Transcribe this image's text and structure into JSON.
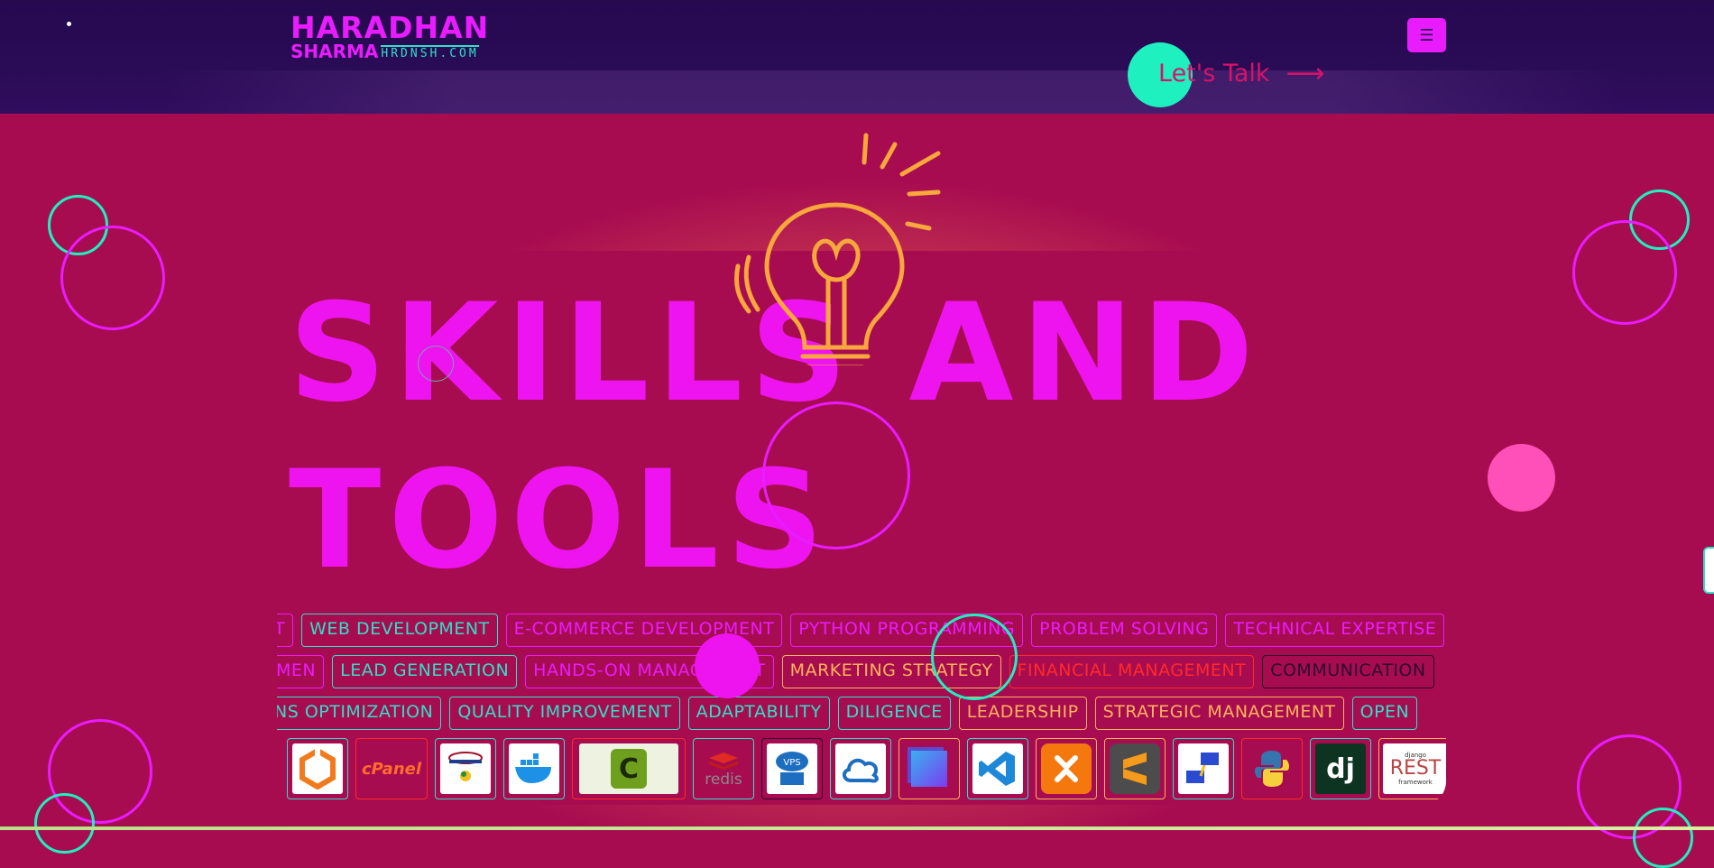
{
  "header": {
    "logo_line1": "HARADHAN",
    "logo_line2": "SHARMA",
    "logo_domain": "HRDNSH.COM",
    "menu_icon": "hamburger-icon",
    "cta_label": "Let's Talk",
    "cta_icon": "arrow-right-icon"
  },
  "hero": {
    "title_line1": "SKILLS AND",
    "title_line2": "TOOLS",
    "decoration_icon": "lightbulb-icon"
  },
  "skills": {
    "row1": [
      {
        "label": "WEB DEVELOPMENT",
        "color": "teal"
      },
      {
        "label": "E-COMMERCE DEVELOPMENT",
        "color": "pink"
      },
      {
        "label": "PYTHON PROGRAMMING",
        "color": "pink"
      },
      {
        "label": "PROBLEM SOLVING",
        "color": "pink"
      },
      {
        "label": "TECHNICAL EXPERTISE",
        "color": "pink"
      }
    ],
    "row1_lead": "T",
    "row2": [
      {
        "label": "LEAD GENERATION",
        "color": "teal"
      },
      {
        "label": "HANDS-ON MANAGEMENT",
        "color": "pink"
      },
      {
        "label": "MARKETING STRATEGY",
        "color": "orange"
      },
      {
        "label": "FINANCIAL MANAGEMENT",
        "color": "red"
      },
      {
        "label": "COMMUNICATION",
        "color": "dark"
      }
    ],
    "row2_lead": "MEN",
    "row3": [
      {
        "label": "QUALITY IMPROVEMENT",
        "color": "teal"
      },
      {
        "label": "ADAPTABILITY",
        "color": "teal"
      },
      {
        "label": "DILIGENCE",
        "color": "teal"
      },
      {
        "label": "LEADERSHIP",
        "color": "orange"
      },
      {
        "label": "STRATEGIC MANAGEMENT",
        "color": "orange"
      },
      {
        "label": "OPEN",
        "color": "teal"
      }
    ],
    "row3_lead": "NS OPTIMIZATION"
  },
  "tools": [
    {
      "icon": "ubuntu-icon",
      "label": ""
    },
    {
      "icon": "cpanel-icon",
      "label": "cPanel"
    },
    {
      "icon": "control-panel-icon",
      "label": ""
    },
    {
      "icon": "docker-icon",
      "label": ""
    },
    {
      "icon": "c-language-icon",
      "label": "C"
    },
    {
      "icon": "redis-icon",
      "label": "redis"
    },
    {
      "icon": "vps-icon",
      "label": "VPS"
    },
    {
      "icon": "cloud-icon",
      "label": ""
    },
    {
      "icon": "gradient-square-icon",
      "label": ""
    },
    {
      "icon": "vscode-icon",
      "label": ""
    },
    {
      "icon": "xampp-icon",
      "label": ""
    },
    {
      "icon": "sublime-text-icon",
      "label": ""
    },
    {
      "icon": "network-icon",
      "label": ""
    },
    {
      "icon": "python-icon",
      "label": ""
    },
    {
      "icon": "django-icon",
      "label": "dj"
    },
    {
      "icon": "django-rest-framework-icon",
      "label": "REST",
      "sublabel": "django",
      "sublabel2": "framework"
    }
  ],
  "colors": {
    "header_bg": "#2a0b56",
    "accent_pink": "#e81cff",
    "accent_teal": "#1ff0c0",
    "card_bg": "#a80c50",
    "glow_orange": "#f4a24a"
  }
}
